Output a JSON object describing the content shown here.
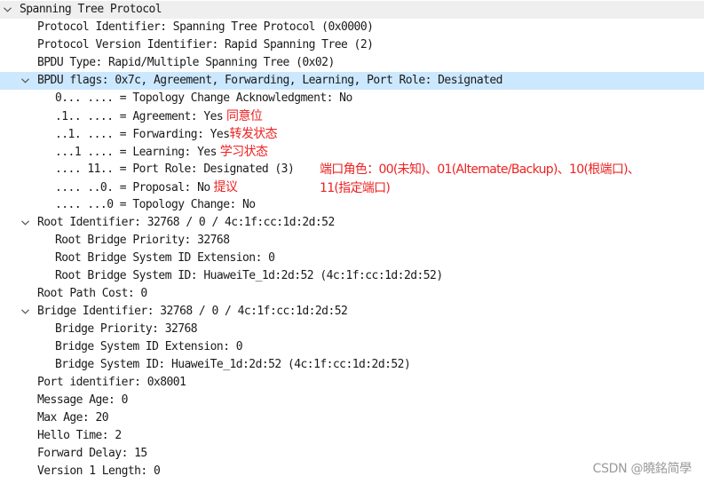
{
  "tree": {
    "root": {
      "label": "Spanning Tree Protocol"
    },
    "protocol_identifier": "Protocol Identifier: Spanning Tree Protocol (0x0000)",
    "protocol_version": "Protocol Version Identifier: Rapid Spanning Tree (2)",
    "bpdu_type": "BPDU Type: Rapid/Multiple Spanning Tree (0x02)",
    "bpdu_flags": {
      "label": "BPDU flags: 0x7c, Agreement, Forwarding, Learning, Port Role: Designated",
      "items": [
        {
          "text": "0... .... = Topology Change Acknowledgment: No",
          "note": ""
        },
        {
          "text": ".1.. .... = Agreement: Yes",
          "note": " 同意位"
        },
        {
          "text": "..1. .... = Forwarding: Yes",
          "note": "转发状态"
        },
        {
          "text": "...1 .... = Learning: Yes",
          "note": " 学习状态"
        },
        {
          "text": ".... 11.. = Port Role: Designated (3)",
          "note": ""
        },
        {
          "text": ".... ..0. = Proposal: No",
          "note": " 提议"
        },
        {
          "text": ".... ...0 = Topology Change: No",
          "note": ""
        }
      ]
    },
    "root_identifier": {
      "label": "Root Identifier: 32768 / 0 / 4c:1f:cc:1d:2d:52",
      "items": [
        "Root Bridge Priority: 32768",
        "Root Bridge System ID Extension: 0",
        "Root Bridge System ID: HuaweiTe_1d:2d:52 (4c:1f:cc:1d:2d:52)"
      ]
    },
    "root_path_cost": "Root Path Cost: 0",
    "bridge_identifier": {
      "label": "Bridge Identifier: 32768 / 0 / 4c:1f:cc:1d:2d:52",
      "items": [
        "Bridge Priority: 32768",
        "Bridge System ID Extension: 0",
        "Bridge System ID: HuaweiTe_1d:2d:52 (4c:1f:cc:1d:2d:52)"
      ]
    },
    "port_identifier": "Port identifier: 0x8001",
    "message_age": "Message Age: 0",
    "max_age": "Max Age: 20",
    "hello_time": "Hello Time: 2",
    "forward_delay": "Forward Delay: 15",
    "version1_length": "Version 1 Length: 0"
  },
  "annotations": {
    "port_role_note_line1": "端口角色：00(未知)、01(Alternate/Backup)、10(根端口)、",
    "port_role_note_line2": "11(指定端口)"
  },
  "watermark": "CSDN @曉銘简學",
  "colors": {
    "annotation": "#ee2222",
    "selected_row": "#cce8ff",
    "root_row": "#efefef"
  }
}
